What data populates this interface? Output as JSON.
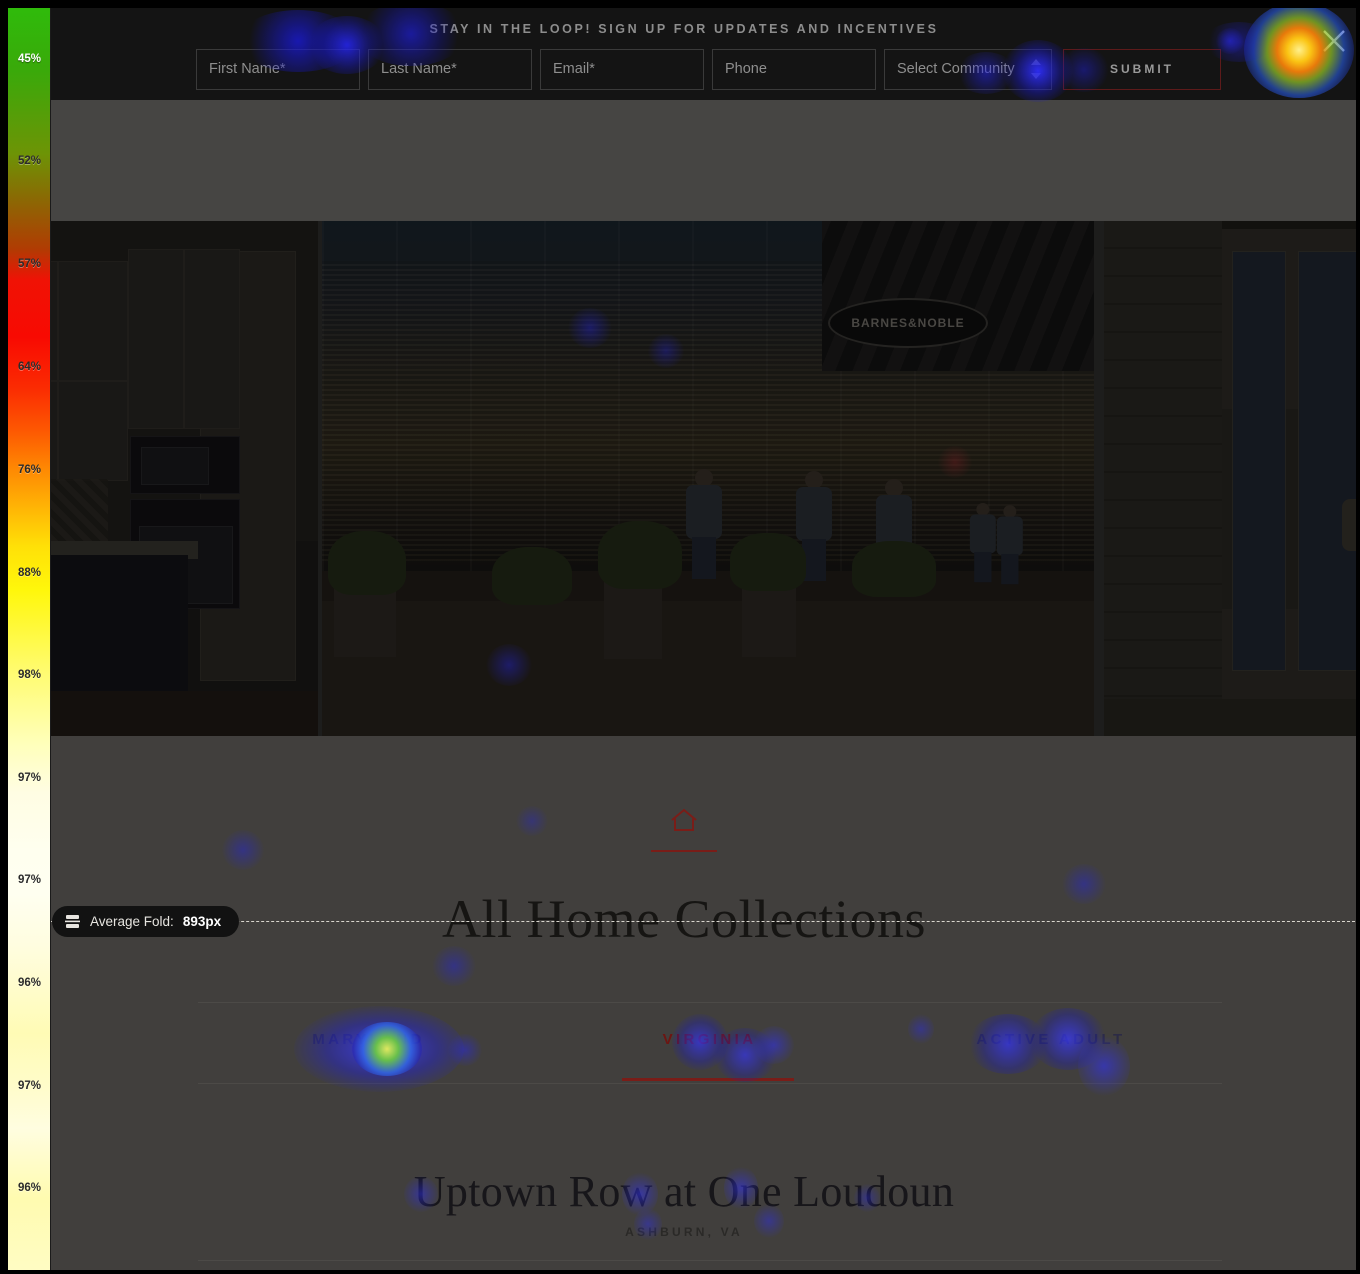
{
  "analytics": {
    "tool": "scrollmap-heatmap-overlay",
    "fold": {
      "label": "Average Fold:",
      "value": "893px",
      "icon": "fold-icon"
    },
    "scroll_gauge": {
      "unit": "%",
      "labels": [
        "45%",
        "52%",
        "57%",
        "64%",
        "76%",
        "88%",
        "98%",
        "97%",
        "97%",
        "96%",
        "97%",
        "96%"
      ],
      "colors": {
        "top": "#2fbb0b",
        "hot": "#f80a02",
        "mid": "#fff70b",
        "bottom": "#fffcc4"
      }
    },
    "click_heatmap": {
      "legend_colors": {
        "cold": "#2020e0",
        "warm": "#36c23a",
        "hot": "#ffd400"
      }
    }
  },
  "signup_bar": {
    "headline": "STAY IN THE LOOP! SIGN UP FOR UPDATES AND INCENTIVES",
    "fields": [
      {
        "name": "first-name",
        "placeholder": "First Name*",
        "value": ""
      },
      {
        "name": "last-name",
        "placeholder": "Last Name*",
        "value": ""
      },
      {
        "name": "email",
        "placeholder": "Email*",
        "value": ""
      },
      {
        "name": "phone",
        "placeholder": "Phone",
        "value": ""
      }
    ],
    "select": {
      "name": "select-community",
      "value": "Select Community"
    },
    "submit_label": "SUBMIT",
    "close_icon": "close-icon",
    "background": "#141414",
    "submit_border": "#5d1a1a"
  },
  "gallery": {
    "slides": [
      {
        "name": "kitchen-interior-photo",
        "alt": "Kitchen with white cabinets, wall oven and dark island"
      },
      {
        "name": "town-center-street-photo",
        "alt": "Outdoor shopping street with glass storefront reflections",
        "sign_text": "BARNES&NOBLE"
      },
      {
        "name": "patio-door-exterior-photo",
        "alt": "Sliding glass patio door on white siding exterior"
      }
    ]
  },
  "content": {
    "emblem_icon": "home-icon",
    "section_title": "All Home Collections",
    "tabs": [
      {
        "name": "tab-maryland",
        "label": "MARYLAND",
        "active": false
      },
      {
        "name": "tab-virginia",
        "label": "VIRGINIA",
        "active": true
      },
      {
        "name": "tab-active-adult",
        "label": "ACTIVE ADULT",
        "active": false
      }
    ],
    "accent_color": "#7a1d18",
    "community": {
      "name": "Uptown Row at One Loudoun",
      "location": "ASHBURN, VA"
    }
  }
}
